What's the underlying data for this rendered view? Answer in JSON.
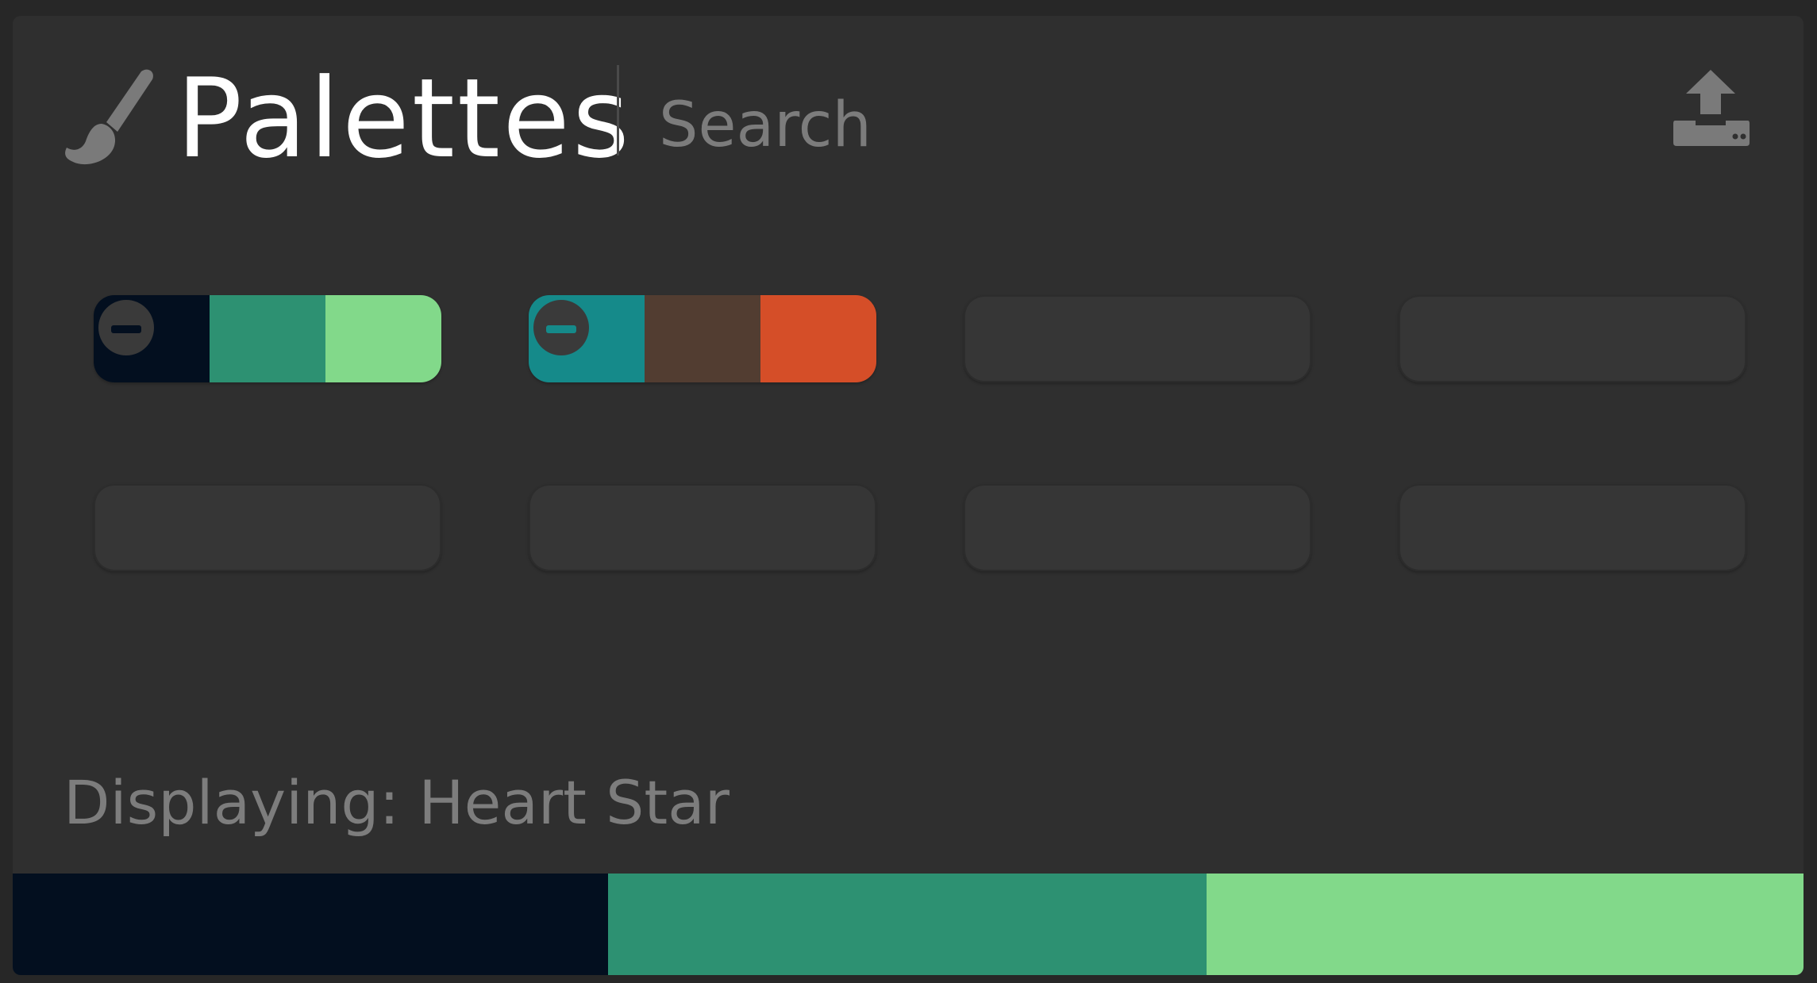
{
  "header": {
    "title": "Palettes",
    "search_placeholder": "Search",
    "brush_icon": "paintbrush-icon",
    "export_icon": "upload-icon"
  },
  "palettes": [
    {
      "name": "Heart Star",
      "colors": [
        "#030f1f",
        "#2d9172",
        "#82d98a"
      ],
      "remove_icon": "minus-icon",
      "minus_color": "#030f1f"
    },
    {
      "name": "",
      "colors": [
        "#158a8a",
        "#523d31",
        "#d54e28"
      ],
      "remove_icon": "minus-icon",
      "minus_color": "#158a8a"
    },
    {
      "name": "",
      "colors": []
    },
    {
      "name": "",
      "colors": []
    },
    {
      "name": "",
      "colors": []
    },
    {
      "name": "",
      "colors": []
    },
    {
      "name": "",
      "colors": []
    },
    {
      "name": "",
      "colors": []
    }
  ],
  "status": {
    "displaying_label": "Displaying: Heart Star"
  },
  "preview": {
    "colors": [
      "#030f1f",
      "#2d9172",
      "#82d98a"
    ]
  },
  "colors": {
    "background": "#272727",
    "panel": "#2f2f2f",
    "empty_slot": "#363636",
    "title": "#ffffff",
    "muted_text": "#7d7d7d"
  }
}
